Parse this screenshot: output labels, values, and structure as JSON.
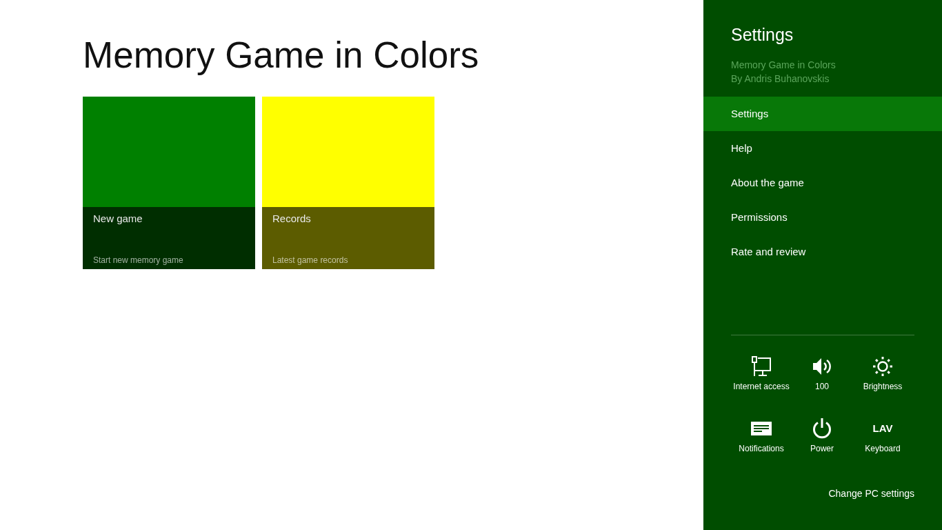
{
  "app": {
    "title": "Memory Game in Colors"
  },
  "tiles": [
    {
      "title": "New game",
      "subtitle": "Start new memory game",
      "color": "#008000"
    },
    {
      "title": "Records",
      "subtitle": "Latest game records",
      "color": "#ffff00"
    }
  ],
  "settings_pane": {
    "title": "Settings",
    "app_name": "Memory Game in Colors",
    "author": "By Andris Buhanovskis",
    "items": [
      {
        "label": "Settings",
        "selected": true
      },
      {
        "label": "Help",
        "selected": false
      },
      {
        "label": "About the game",
        "selected": false
      },
      {
        "label": "Permissions",
        "selected": false
      },
      {
        "label": "Rate and review",
        "selected": false
      }
    ],
    "quick_settings": [
      {
        "kind": "network",
        "label": "Internet access"
      },
      {
        "kind": "volume",
        "label": "100"
      },
      {
        "kind": "brightness",
        "label": "Brightness"
      },
      {
        "kind": "notifications",
        "label": "Notifications"
      },
      {
        "kind": "power",
        "label": "Power"
      },
      {
        "kind": "keyboard",
        "label": "Keyboard",
        "symbol": "LAV"
      }
    ],
    "change_pc_settings": "Change PC settings"
  }
}
